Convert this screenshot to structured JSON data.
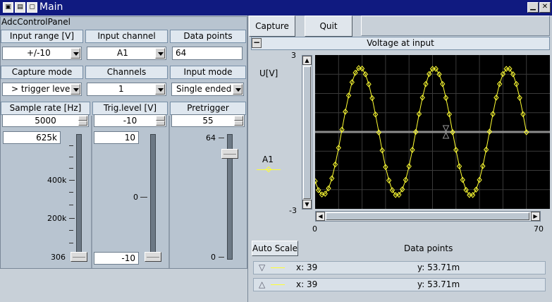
{
  "window": {
    "title": "Main"
  },
  "panel": {
    "label": "AdcControlPanel",
    "input_range": {
      "header": "Input range [V]",
      "value": "+/-10"
    },
    "input_channel": {
      "header": "Input channel",
      "value": "A1"
    },
    "data_points": {
      "header": "Data points",
      "value": "64"
    },
    "capture_mode": {
      "header": "Capture mode",
      "value": "> trigger level"
    },
    "channels": {
      "header": "Channels",
      "value": "1"
    },
    "input_mode": {
      "header": "Input mode",
      "value": "Single ended"
    },
    "sample_rate": {
      "header": "Sample rate [Hz]",
      "spin": "5000",
      "value": "625k",
      "labels": [
        "400k",
        "200k",
        "306"
      ]
    },
    "trig_level": {
      "header": "Trig.level [V]",
      "spin": "-10",
      "value": "10",
      "label_mid": "0",
      "bottom": "-10"
    },
    "pretrigger": {
      "header": "Pretrigger",
      "spin": "55",
      "top": "64",
      "bottom": "0"
    }
  },
  "toolbar": {
    "capture": "Capture",
    "quit": "Quit"
  },
  "chart": {
    "header": "Voltage at input",
    "ylabel": "U[V]",
    "series_label": "A1",
    "ytop": "3",
    "ybottom": "-3",
    "xleft": "0",
    "xright": "70",
    "xlabel": "Data points",
    "autoscale": "Auto Scale",
    "cursor1": {
      "x": "x: 39",
      "y": "y: 53.71m"
    },
    "cursor2": {
      "x": "x: 39",
      "y": "y: 53.71m"
    }
  },
  "chart_data": {
    "type": "line",
    "title": "Voltage at input",
    "xlabel": "Data points",
    "ylabel": "U[V]",
    "xlim": [
      0,
      70
    ],
    "ylim": [
      -3,
      3
    ],
    "series": [
      {
        "name": "A1",
        "x": [
          0,
          1,
          2,
          3,
          4,
          5,
          6,
          7,
          8,
          9,
          10,
          11,
          12,
          13,
          14,
          15,
          16,
          17,
          18,
          19,
          20,
          21,
          22,
          23,
          24,
          25,
          26,
          27,
          28,
          29,
          30,
          31,
          32,
          33,
          34,
          35,
          36,
          37,
          38,
          39,
          40,
          41,
          42,
          43,
          44,
          45,
          46,
          47,
          48,
          49,
          50,
          51,
          52,
          53,
          54,
          55,
          56,
          57,
          58,
          59,
          60,
          61,
          62,
          63
        ],
        "y": [
          -1.92,
          -2.27,
          -2.44,
          -2.41,
          -2.2,
          -1.81,
          -1.27,
          -0.62,
          0.09,
          0.79,
          1.42,
          1.94,
          2.31,
          2.49,
          2.47,
          2.25,
          1.86,
          1.32,
          0.68,
          -0.02,
          -0.72,
          -1.37,
          -1.89,
          -2.27,
          -2.46,
          -2.45,
          -2.24,
          -1.87,
          -1.34,
          -0.7,
          0.0,
          0.7,
          1.34,
          1.87,
          2.26,
          2.46,
          2.46,
          2.25,
          1.87,
          1.33,
          0.69,
          -0.01,
          -0.7,
          -1.34,
          -1.87,
          -2.26,
          -2.46,
          -2.46,
          -2.25,
          -1.87,
          -1.33,
          -0.69,
          0.01,
          0.7,
          1.34,
          1.87,
          2.26,
          2.46,
          2.46,
          2.25,
          1.87,
          1.33,
          0.69,
          -0.01
        ]
      }
    ],
    "grid": true,
    "line_color": "#ffff33",
    "cursor_x": 39
  },
  "colors": {
    "titlebar": "#101a80",
    "plot_bg": "#000000",
    "trace": "#ffff33"
  }
}
